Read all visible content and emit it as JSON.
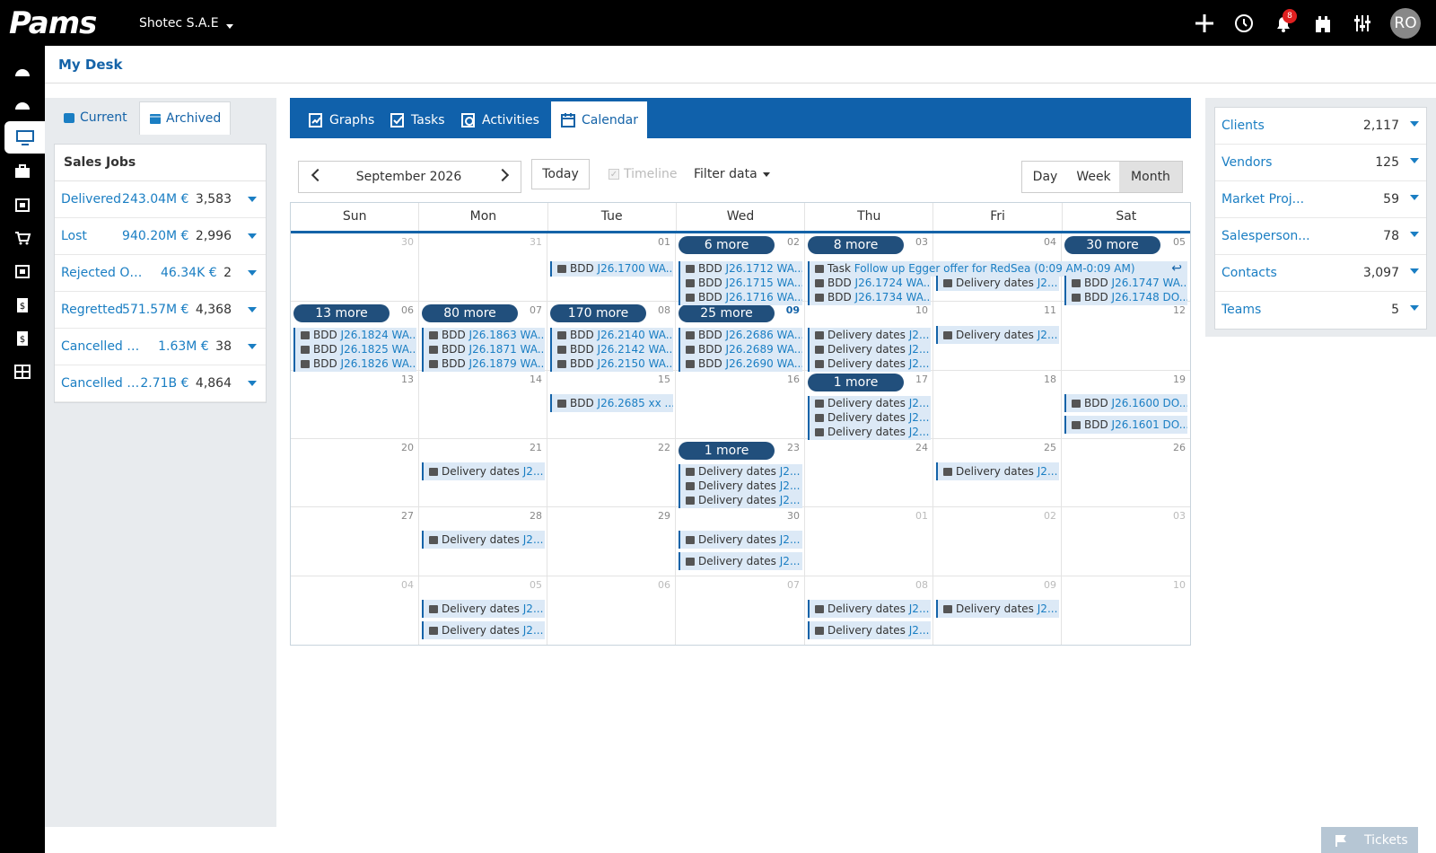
{
  "app": {
    "logo": "Pams",
    "company": "Shotec S.A.E",
    "notifications_count": "8",
    "user_initials": "RO"
  },
  "page": {
    "title": "My Desk"
  },
  "left": {
    "tabs": [
      {
        "label": "Current"
      },
      {
        "label": "Archived"
      }
    ],
    "sales_jobs": {
      "title": "Sales Jobs",
      "items": [
        {
          "label": "Delivered",
          "amount": "243.04M €",
          "count": "3,583"
        },
        {
          "label": "Lost",
          "amount": "940.20M €",
          "count": "2,996"
        },
        {
          "label": "Rejected Or...",
          "amount": "46.34K €",
          "count": "2"
        },
        {
          "label": "Regretted",
          "amount": "571.57M €",
          "count": "4,368"
        },
        {
          "label": "Cancelled O...",
          "amount": "1.63M €",
          "count": "38"
        },
        {
          "label": "Cancelled R...",
          "amount": "2.71B €",
          "count": "4,864"
        }
      ]
    }
  },
  "main": {
    "tabs": [
      {
        "label": "Graphs"
      },
      {
        "label": "Tasks"
      },
      {
        "label": "Activities"
      },
      {
        "label": "Calendar"
      }
    ],
    "toolbar": {
      "month": "September 2026",
      "today": "Today",
      "timeline": "Timeline",
      "filter": "Filter data",
      "views": [
        "Day",
        "Week",
        "Month"
      ]
    },
    "weekdays": [
      "Sun",
      "Mon",
      "Tue",
      "Wed",
      "Thu",
      "Fri",
      "Sat"
    ],
    "weeks": [
      [
        "30",
        "31",
        "01",
        "02",
        "03",
        "04",
        "05"
      ],
      [
        "06",
        "07",
        "08",
        "09",
        "10",
        "11",
        "12"
      ],
      [
        "13",
        "14",
        "15",
        "16",
        "17",
        "18",
        "19"
      ],
      [
        "20",
        "21",
        "22",
        "23",
        "24",
        "25",
        "26"
      ],
      [
        "27",
        "28",
        "29",
        "30",
        "01",
        "02",
        "03"
      ],
      [
        "04",
        "05",
        "06",
        "07",
        "08",
        "09",
        "10"
      ]
    ],
    "more_labels": [
      "6 more",
      "8 more",
      "30 more",
      "13 more",
      "80 more",
      "170 more",
      "25 more",
      "1 more",
      "1 more"
    ],
    "events": [
      {
        "p": "BDD",
        "l": "J26.1700 WA..."
      },
      {
        "p": "BDD",
        "l": "J26.1712 WA..."
      },
      {
        "p": "BDD",
        "l": "J26.1715 WA..."
      },
      {
        "p": "BDD",
        "l": "J26.1716 WA..."
      },
      {
        "p": "Task",
        "l": "Follow up Egger offer for RedSea (0:09 AM-0:09 AM)"
      },
      {
        "p": "BDD",
        "l": "J26.1724 WA..."
      },
      {
        "p": "BDD",
        "l": "J26.1734 WA..."
      },
      {
        "p": "Delivery dates",
        "l": "J2..."
      },
      {
        "p": "BDD",
        "l": "J26.1747 WA..."
      },
      {
        "p": "BDD",
        "l": "J26.1748 DO..."
      },
      {
        "p": "BDD",
        "l": "J26.1824 WA..."
      },
      {
        "p": "BDD",
        "l": "J26.1825 WA..."
      },
      {
        "p": "BDD",
        "l": "J26.1826 WA..."
      },
      {
        "p": "BDD",
        "l": "J26.1863 WA..."
      },
      {
        "p": "BDD",
        "l": "J26.1871 WA..."
      },
      {
        "p": "BDD",
        "l": "J26.1879 WA..."
      },
      {
        "p": "BDD",
        "l": "J26.2140 WA..."
      },
      {
        "p": "BDD",
        "l": "J26.2142 WA..."
      },
      {
        "p": "BDD",
        "l": "J26.2150 WA..."
      },
      {
        "p": "BDD",
        "l": "J26.2686 WA..."
      },
      {
        "p": "BDD",
        "l": "J26.2689 WA..."
      },
      {
        "p": "BDD",
        "l": "J26.2690 WA..."
      },
      {
        "p": "Delivery dates",
        "l": "J2..."
      },
      {
        "p": "Delivery dates",
        "l": "J2..."
      },
      {
        "p": "Delivery dates",
        "l": "J2..."
      },
      {
        "p": "Delivery dates",
        "l": "J2..."
      },
      {
        "p": "BDD",
        "l": "J26.2685 xx ..."
      },
      {
        "p": "Delivery dates",
        "l": "J2..."
      },
      {
        "p": "Delivery dates",
        "l": "J2..."
      },
      {
        "p": "Delivery dates",
        "l": "J2..."
      },
      {
        "p": "BDD",
        "l": "J26.1600 DO..."
      },
      {
        "p": "BDD",
        "l": "J26.1601 DO..."
      },
      {
        "p": "Delivery dates",
        "l": "J2..."
      },
      {
        "p": "Delivery dates",
        "l": "J2..."
      },
      {
        "p": "Delivery dates",
        "l": "J2..."
      },
      {
        "p": "Delivery dates",
        "l": "J2..."
      },
      {
        "p": "Delivery dates",
        "l": "J2..."
      },
      {
        "p": "Delivery dates",
        "l": "J2..."
      },
      {
        "p": "Delivery dates",
        "l": "J2..."
      },
      {
        "p": "Delivery dates",
        "l": "J2..."
      },
      {
        "p": "Delivery dates",
        "l": "J2..."
      },
      {
        "p": "Delivery dates",
        "l": "J2..."
      },
      {
        "p": "Delivery dates",
        "l": "J2..."
      },
      {
        "p": "Delivery dates",
        "l": "J2..."
      },
      {
        "p": "Delivery dates",
        "l": "J2..."
      }
    ]
  },
  "right": {
    "items": [
      {
        "label": "Clients",
        "count": "2,117"
      },
      {
        "label": "Vendors",
        "count": "125"
      },
      {
        "label": "Market Proj...",
        "count": "59"
      },
      {
        "label": "Salesperson...",
        "count": "78"
      },
      {
        "label": "Contacts",
        "count": "3,097"
      },
      {
        "label": "Teams",
        "count": "5"
      }
    ]
  },
  "footer": {
    "tickets": "Tickets"
  }
}
